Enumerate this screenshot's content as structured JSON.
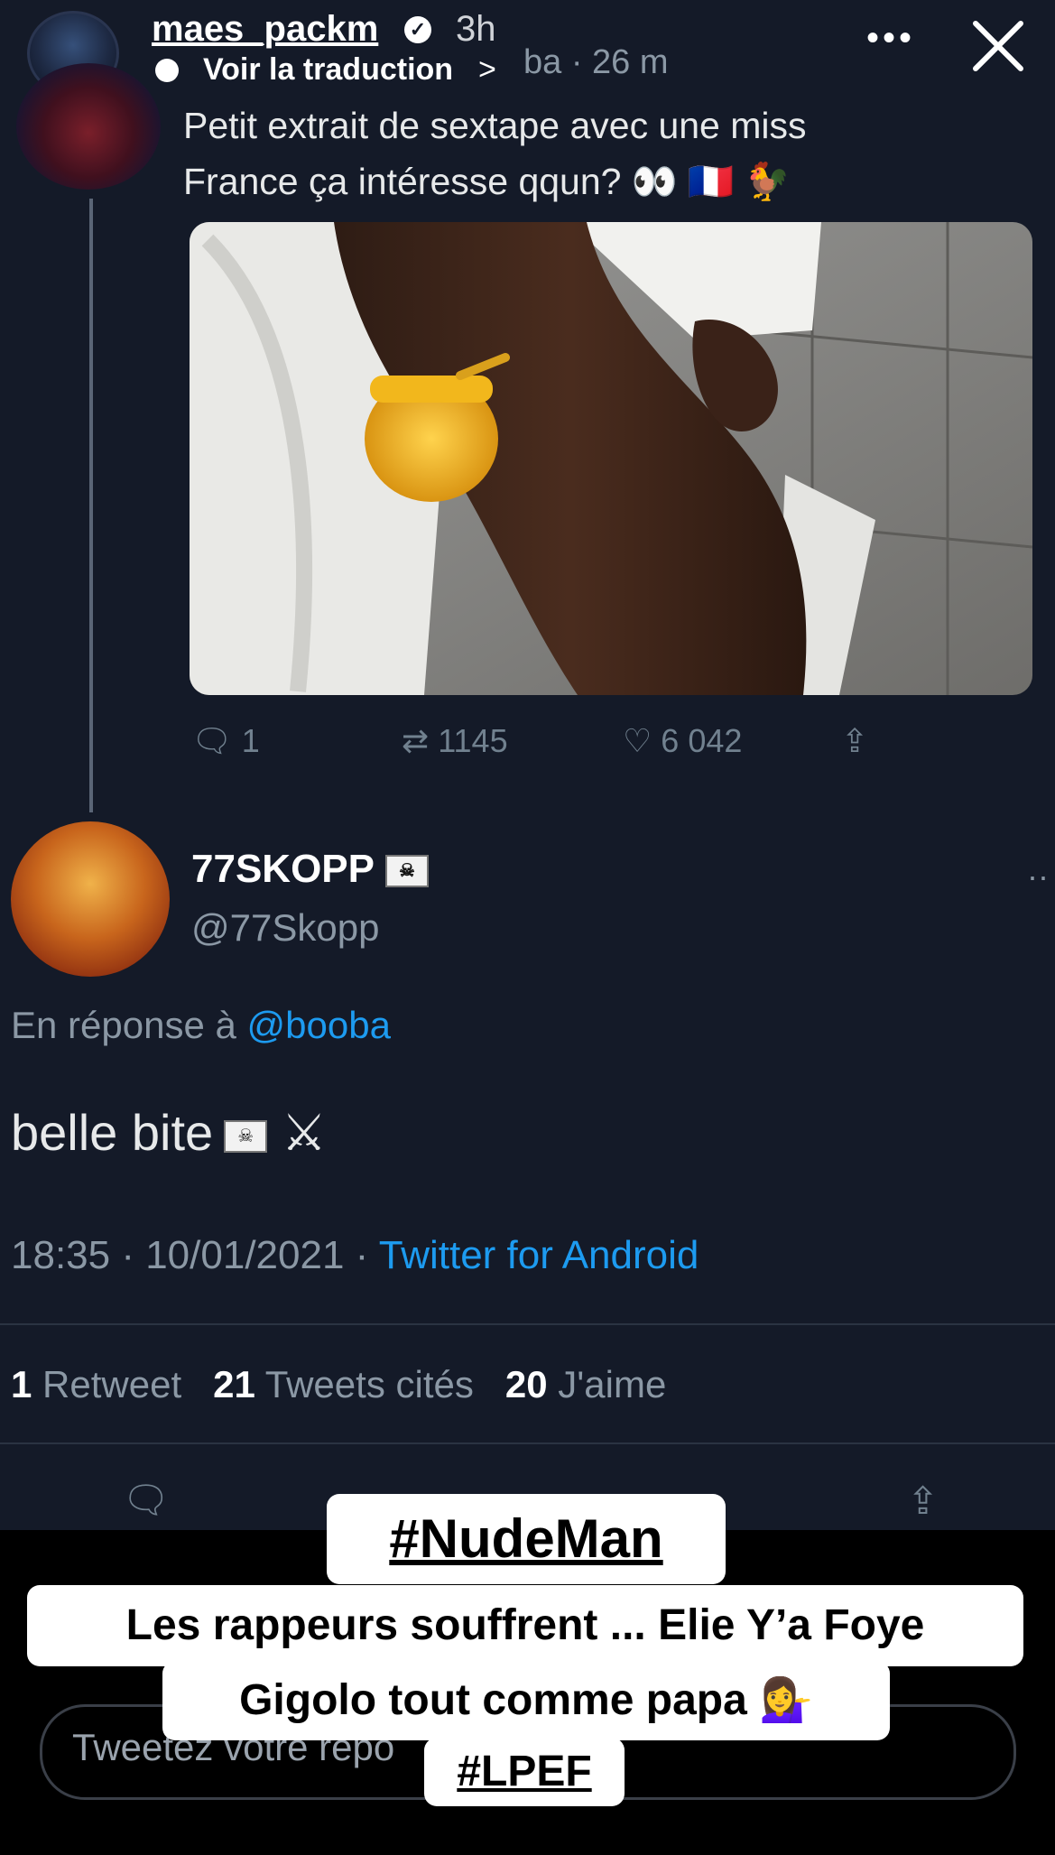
{
  "story": {
    "username": "maes_packm",
    "time": "3h",
    "translate_label": "Voir la traduction",
    "translate_chevron": ">",
    "more_label": "•••",
    "close_label": "✕"
  },
  "tweet1": {
    "handle_time": "ba · 26 m",
    "text_line1": "Petit extrait de sextape avec une miss",
    "text_line2": "France ça intéresse qqun? 👀 🇫🇷 🐓",
    "replies": "1",
    "retweets": "1145",
    "likes": "6 042"
  },
  "tweet2": {
    "name": "77SKOPP",
    "flag": "☠",
    "handle": "@77Skopp",
    "reply_prefix": "En réponse à",
    "reply_mention": "@booba",
    "text": "belle bite",
    "text_flag": "☠",
    "text_swords": "⚔",
    "time": "18:35 · 10/01/2021 ·",
    "source": "Twitter for Android",
    "stat_rt_count": "1",
    "stat_rt_label": "Retweet",
    "stat_quotes_count": "21",
    "stat_quotes_label": "Tweets cités",
    "stat_likes_count": "20",
    "stat_likes_label": "J'aime"
  },
  "composer": {
    "placeholder": "Tweetez votre repo"
  },
  "stickers": {
    "hashtag1": "#NudeMan",
    "line1": "Les rappeurs souffrent ... Elie Y’a Foye",
    "line2": "Gigolo tout comme papa 💁‍♀️",
    "hashtag2": "#LPEF"
  },
  "colors": {
    "background": "#141a28",
    "link": "#1d9bf0",
    "muted": "#8b98a5"
  }
}
